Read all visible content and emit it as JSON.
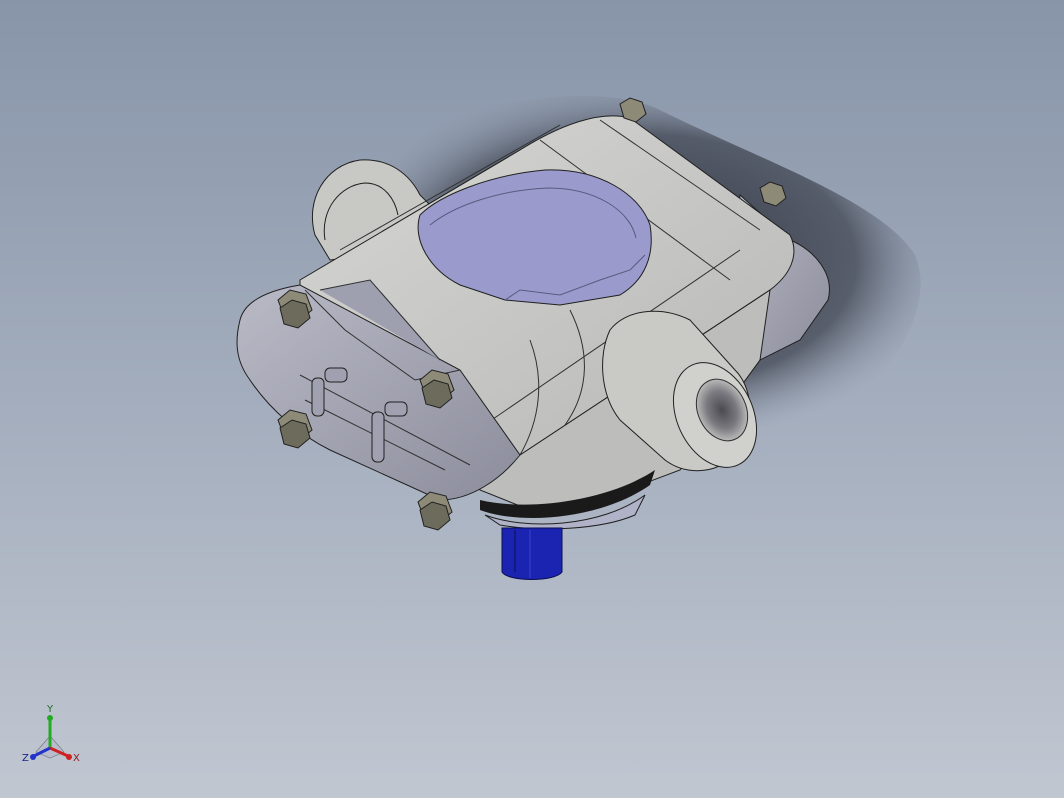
{
  "viewport": {
    "background_top": "#8895a9",
    "background_bottom": "#c1c7d1",
    "model_name": "",
    "part_colors": {
      "housing": "#c9c9c6",
      "housing_shadow": "#9c9ca1",
      "end_cap": "#a9aab6",
      "lid": "#9a9bcc",
      "bolts": "#8d8a78",
      "shaft": "#1b24b0",
      "gasket": "#1a1a1a"
    }
  },
  "triad": {
    "x_label": "X",
    "y_label": "Y",
    "z_label": "Z",
    "x_color": "#cc2222",
    "y_color": "#22aa22",
    "z_color": "#2233cc"
  }
}
